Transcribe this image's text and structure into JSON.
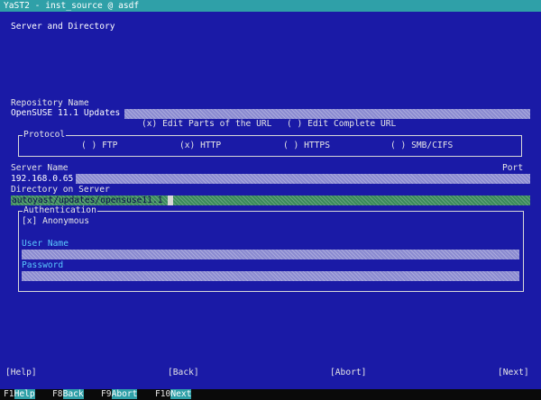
{
  "window": {
    "title": "YaST2 - inst_source @ asdf"
  },
  "heading": "Server and Directory",
  "repo_name": {
    "label": "Repository Name",
    "value": "OpenSUSE 11.1 Updates"
  },
  "url_mode": {
    "parts": "(x) Edit Parts of the URL",
    "complete": "( ) Edit Complete URL"
  },
  "protocol": {
    "legend": "Protocol",
    "options": [
      "( ) FTP",
      "(x) HTTP",
      "( ) HTTPS",
      "( ) SMB/CIFS"
    ]
  },
  "server": {
    "label": "Server Name",
    "value": "192.168.0.65",
    "port_label": "Port"
  },
  "directory": {
    "label": "Directory on Server",
    "value": "autoyast/updates/opensuse11.1"
  },
  "auth": {
    "legend": "Authentication",
    "anonymous": "[x] Anonymous",
    "username_label": "User Name",
    "password_label": "Password"
  },
  "buttons": {
    "help": "[Help]",
    "back": "[Back]",
    "abort": "[Abort]",
    "next": "[Next]"
  },
  "fkeys": [
    {
      "key": "F1",
      "label": "Help"
    },
    {
      "key": "F8",
      "label": "Back"
    },
    {
      "key": "F9",
      "label": "Abort"
    },
    {
      "key": "F10",
      "label": "Next"
    }
  ]
}
